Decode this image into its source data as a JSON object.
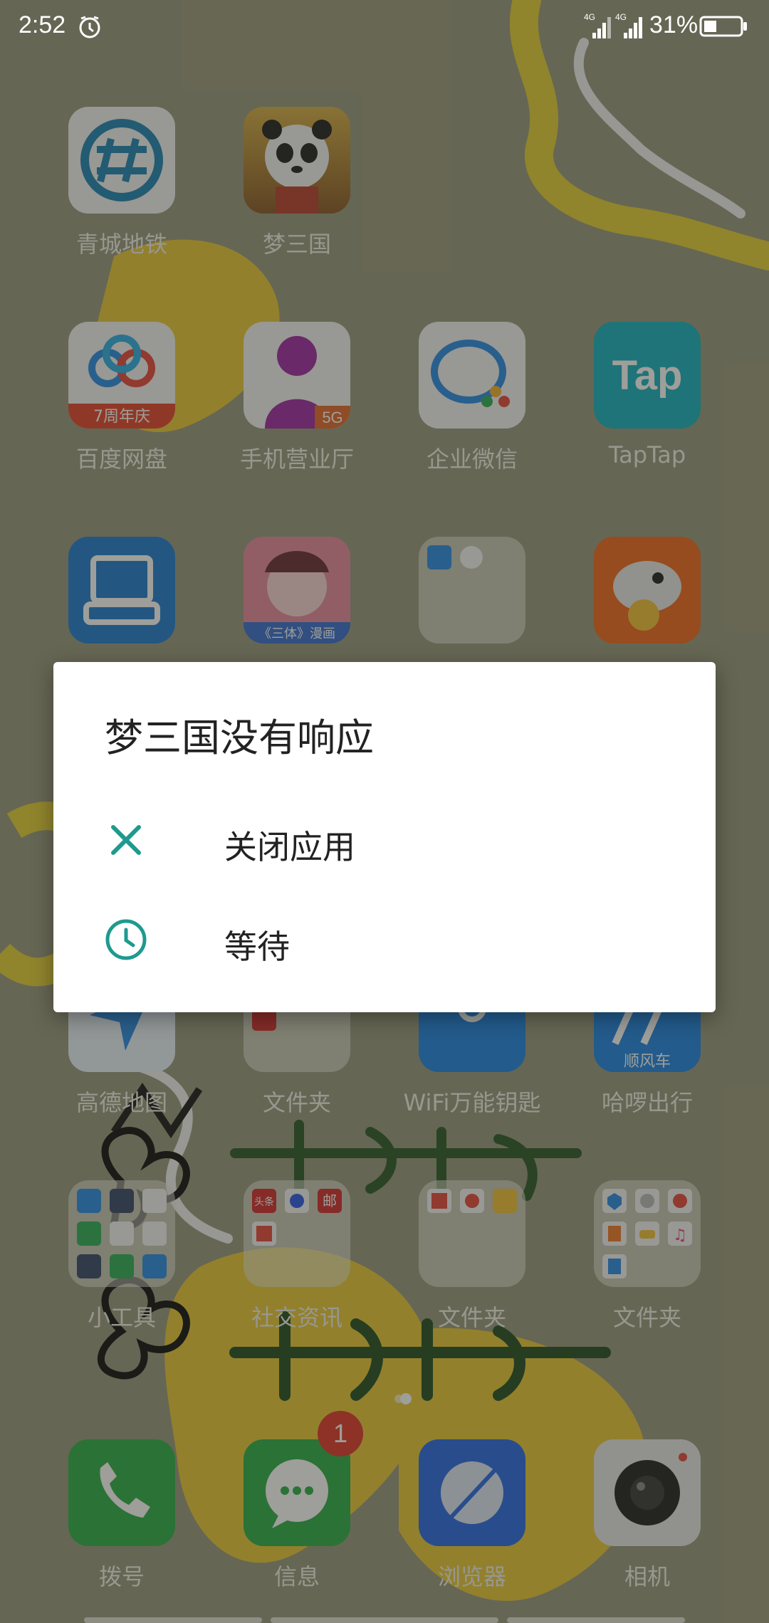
{
  "status_bar": {
    "time": "2:52",
    "network1": "4G",
    "network2": "4G",
    "battery": "31%"
  },
  "apps": {
    "row1": [
      {
        "label": "青城地铁",
        "icon": "metro-icon"
      },
      {
        "label": "梦三国",
        "icon": "panda-game-icon"
      }
    ],
    "row2": [
      {
        "label": "百度网盘",
        "icon": "baidu-netdisk-icon",
        "tag": "7周年庆"
      },
      {
        "label": "手机营业厅",
        "icon": "unicom-icon",
        "tag": "5G"
      },
      {
        "label": "企业微信",
        "icon": "wecom-icon"
      },
      {
        "label": "TapTap",
        "icon": "taptap-icon",
        "tag": "Tap"
      }
    ],
    "row3_icons": [
      {
        "icon": "scanner-icon"
      },
      {
        "icon": "comic-icon",
        "tag": "《三体》漫画"
      },
      {
        "icon": "folder-icon"
      },
      {
        "icon": "shark-icon"
      }
    ],
    "row4": [
      {
        "label": "高德地图",
        "icon": "amap-icon"
      },
      {
        "label": "文件夹",
        "icon": "folder-icon"
      },
      {
        "label": "WiFi万能钥匙",
        "icon": "wifi-key-icon"
      },
      {
        "label": "哈啰出行",
        "icon": "hellobike-icon",
        "tag": "顺风车"
      }
    ],
    "row5": [
      {
        "label": "小工具",
        "icon": "tools-folder-icon"
      },
      {
        "label": "社交资讯",
        "icon": "social-folder-icon",
        "tag1": "头条",
        "tag2": "邮"
      },
      {
        "label": "文件夹",
        "icon": "folder-icon"
      },
      {
        "label": "文件夹",
        "icon": "folder-icon"
      }
    ],
    "dock": [
      {
        "label": "拨号",
        "icon": "phone-icon"
      },
      {
        "label": "信息",
        "icon": "message-icon",
        "badge": "1"
      },
      {
        "label": "浏览器",
        "icon": "browser-icon"
      },
      {
        "label": "相机",
        "icon": "camera-icon"
      }
    ]
  },
  "dialog": {
    "title": "梦三国没有响应",
    "options": [
      {
        "label": "关闭应用",
        "icon": "close-icon"
      },
      {
        "label": "等待",
        "icon": "clock-icon"
      }
    ]
  },
  "colors": {
    "accent": "#1e9a8e",
    "badge": "#e23b2e",
    "wallpaper": "#8f8f78"
  }
}
